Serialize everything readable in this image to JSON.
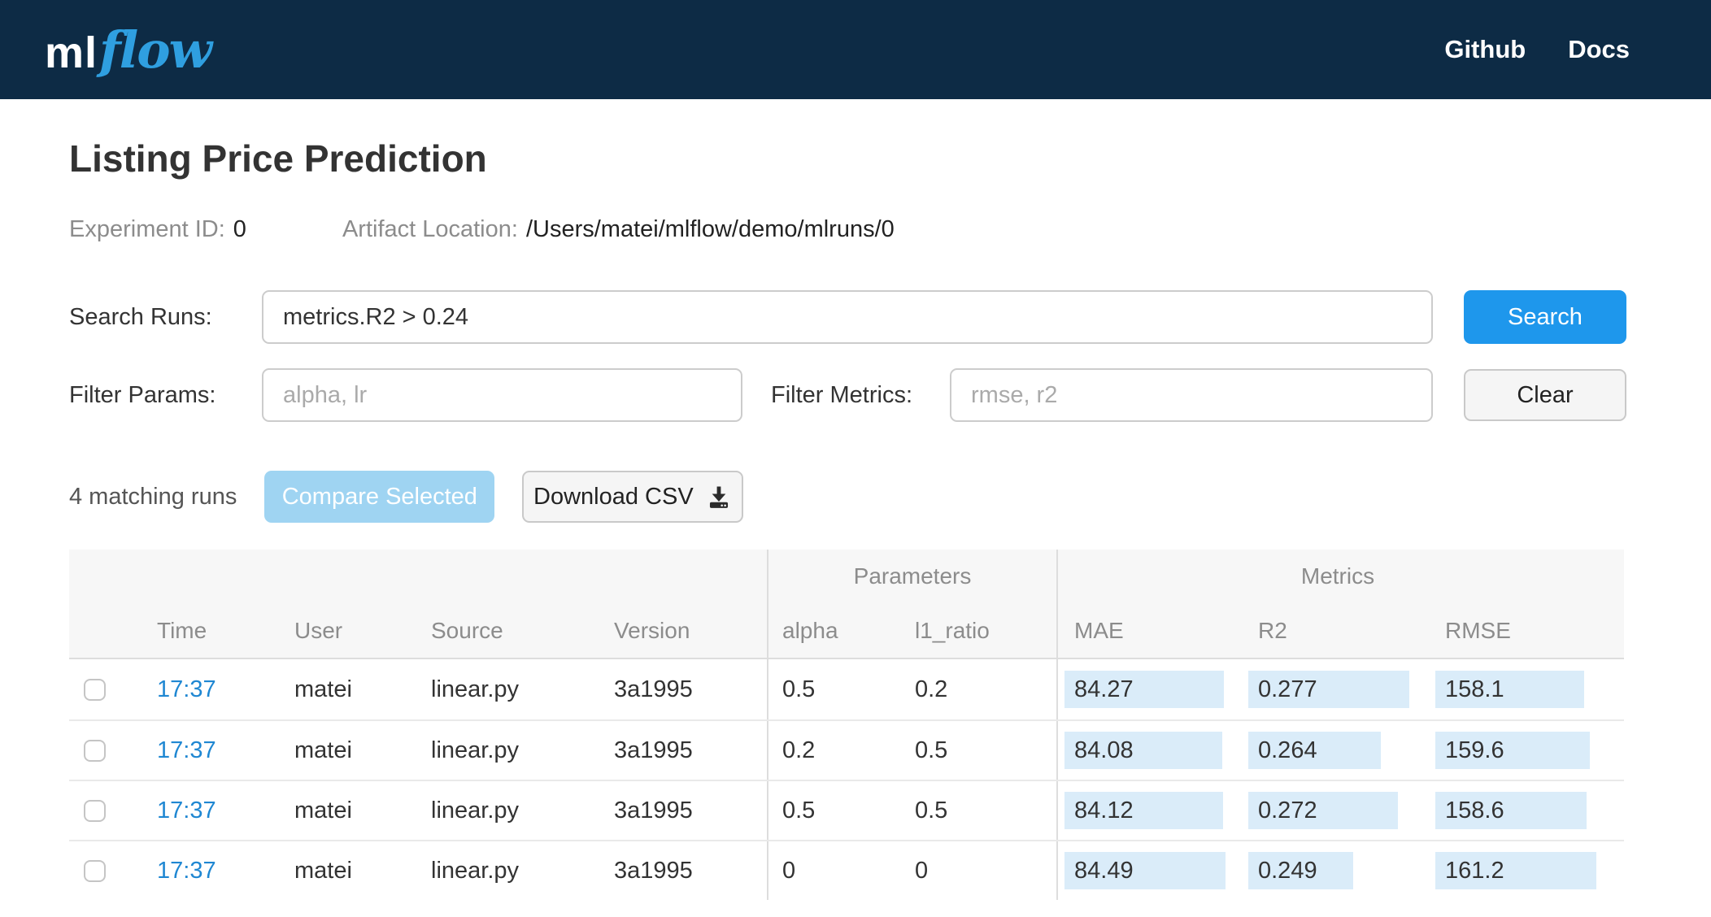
{
  "navbar": {
    "logo_ml": "ml",
    "logo_flow": "flow",
    "links": [
      {
        "label": "Github"
      },
      {
        "label": "Docs"
      }
    ]
  },
  "header": {
    "title": "Listing Price Prediction",
    "experiment_id_label": "Experiment ID:",
    "experiment_id": "0",
    "artifact_location_label": "Artifact Location:",
    "artifact_location": "/Users/matei/mlflow/demo/mlruns/0"
  },
  "search": {
    "label": "Search Runs:",
    "value": "metrics.R2 > 0.24",
    "button_label": "Search"
  },
  "filters": {
    "params_label": "Filter Params:",
    "params_placeholder": "alpha, lr",
    "metrics_label": "Filter Metrics:",
    "metrics_placeholder": "rmse, r2",
    "clear_button_label": "Clear"
  },
  "actions": {
    "matching_runs": "4 matching runs",
    "compare_button_label": "Compare Selected",
    "download_button_label": "Download CSV",
    "download_icon": "download-to-disk-icon"
  },
  "table": {
    "groups": {
      "parameters": "Parameters",
      "metrics": "Metrics"
    },
    "columns": [
      "Time",
      "User",
      "Source",
      "Version",
      "alpha",
      "l1_ratio",
      "MAE",
      "R2",
      "RMSE"
    ],
    "rows": [
      {
        "time": "17:37",
        "user": "matei",
        "source": "linear.py",
        "version": "3a1995",
        "alpha": "0.5",
        "l1_ratio": "0.2",
        "mae": 84.27,
        "r2": 0.277,
        "rmse": 158.1
      },
      {
        "time": "17:37",
        "user": "matei",
        "source": "linear.py",
        "version": "3a1995",
        "alpha": "0.2",
        "l1_ratio": "0.5",
        "mae": 84.08,
        "r2": 0.264,
        "rmse": 159.6
      },
      {
        "time": "17:37",
        "user": "matei",
        "source": "linear.py",
        "version": "3a1995",
        "alpha": "0.5",
        "l1_ratio": "0.5",
        "mae": 84.12,
        "r2": 0.272,
        "rmse": 158.6
      },
      {
        "time": "17:37",
        "user": "matei",
        "source": "linear.py",
        "version": "3a1995",
        "alpha": "0",
        "l1_ratio": "0",
        "mae": 84.49,
        "r2": 0.249,
        "rmse": 161.2
      }
    ]
  },
  "colors": {
    "navbar_bg": "#0d2b45",
    "logo_flow_blue": "#2f9fe0",
    "primary_button_blue": "#1e97ec",
    "disabled_button_blue": "#9fd4f2",
    "link_blue": "#1f87d2",
    "metric_bar_bg": "#daecf9",
    "table_header_bg": "#f7f7f7",
    "muted_text": "#8c8c8c"
  }
}
